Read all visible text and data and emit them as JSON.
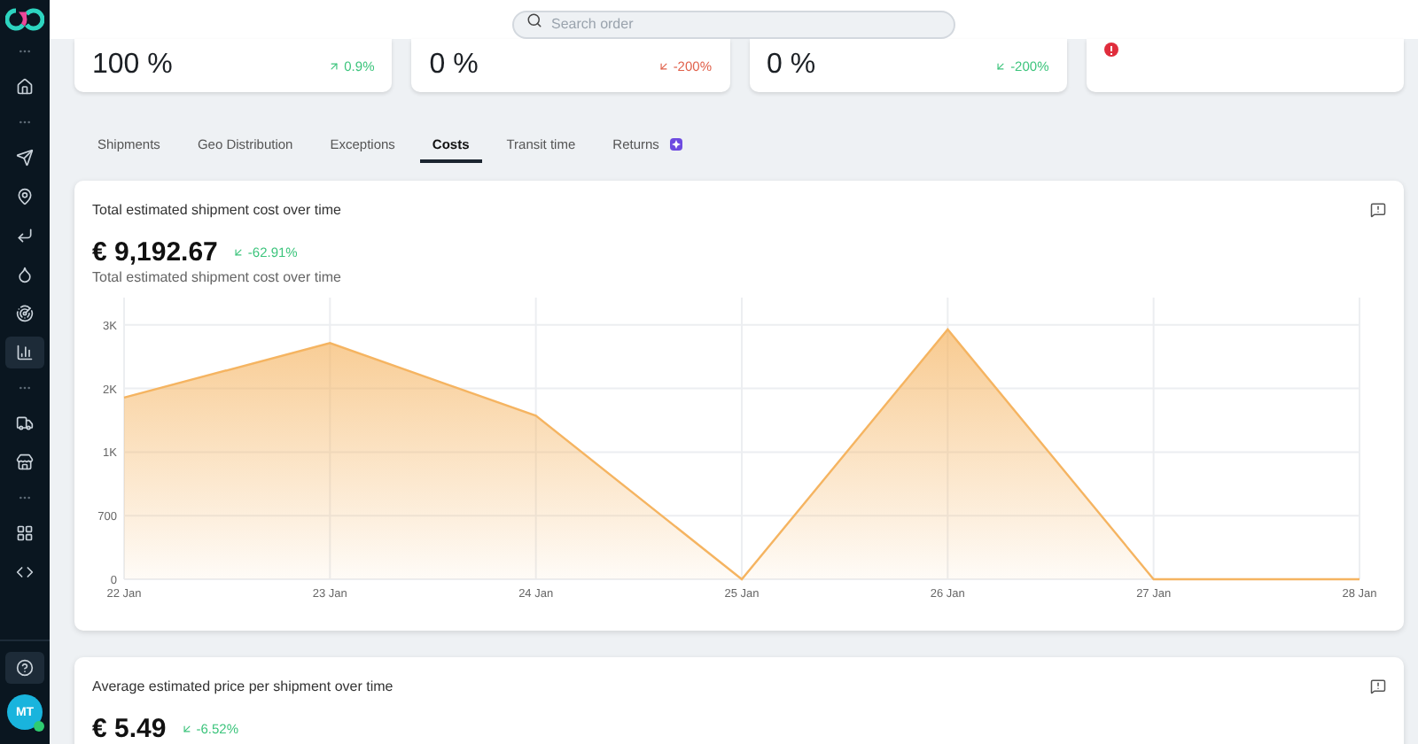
{
  "sidebar": {
    "items": [
      {
        "selected": false
      },
      {
        "selected": false
      },
      {
        "selected": false
      },
      {
        "selected": false
      },
      {
        "selected": false
      },
      {
        "selected": false
      },
      {
        "selected": true
      },
      {
        "selected": false
      },
      {
        "selected": false
      },
      {
        "selected": false
      },
      {
        "selected": false
      }
    ],
    "help": {
      "selected": true
    },
    "avatar": {
      "initials": "MT",
      "online": true
    }
  },
  "search": {
    "placeholder": "Search order"
  },
  "kpis": [
    {
      "value": "100 %",
      "trend": {
        "text": "0.9%",
        "kind": "up",
        "color": "#3cc47c"
      }
    },
    {
      "value": "0 %",
      "trend": {
        "text": "-200%",
        "kind": "down",
        "color": "#e0604a"
      }
    },
    {
      "value": "0 %",
      "trend": {
        "text": "-200%",
        "kind": "down",
        "color": "#3cc47c"
      }
    },
    {
      "alert": true
    }
  ],
  "tabs": [
    {
      "label": "Shipments",
      "selected": false
    },
    {
      "label": "Geo Distribution",
      "selected": false
    },
    {
      "label": "Exceptions",
      "selected": false
    },
    {
      "label": "Costs",
      "selected": true
    },
    {
      "label": "Transit time",
      "selected": false
    },
    {
      "label": "Returns",
      "selected": false,
      "badge": true
    }
  ],
  "cards": [
    {
      "title": "Total estimated shipment cost over time",
      "value": "€ 9,192.67",
      "trend": {
        "text": "-62.91%",
        "kind": "down",
        "color": "#3cc47c"
      },
      "subtitle": "Total estimated shipment cost over time",
      "chart_data": {
        "type": "area",
        "categories": [
          "22 Jan",
          "23 Jan",
          "24 Jan",
          "25 Jan",
          "26 Jan",
          "27 Jan",
          "28 Jan"
        ],
        "series": [
          {
            "color": "#f5b461",
            "values": [
              2000,
              2600,
              1800,
              0,
              2750,
              0,
              0
            ]
          }
        ],
        "ylim": [
          0,
          3100
        ],
        "grid": true,
        "yticks": [
          {
            "value": 0,
            "label": "0"
          },
          {
            "value": 700,
            "label": "700"
          },
          {
            "value": 1400,
            "label": "1K"
          },
          {
            "value": 2100,
            "label": "2K"
          },
          {
            "value": 2800,
            "label": "3K"
          }
        ]
      }
    },
    {
      "title": "Average estimated price per shipment over time",
      "value": "€ 5.49",
      "trend": {
        "text": "-6.52%",
        "kind": "down",
        "color": "#3cc47c"
      }
    }
  ]
}
